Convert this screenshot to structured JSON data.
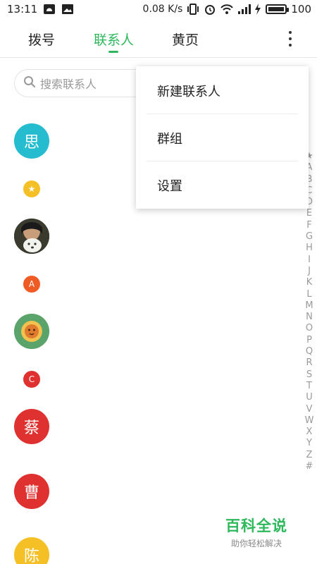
{
  "statusbar": {
    "time": "13:11",
    "speed": "0.08 K/s",
    "battery": "100",
    "battery_level": 1.0
  },
  "tabs": [
    {
      "label": "拨号",
      "active": false
    },
    {
      "label": "联系人",
      "active": true
    },
    {
      "label": "黄页",
      "active": false
    }
  ],
  "search": {
    "placeholder": "搜索联系人"
  },
  "contacts": {
    "avatar_si": "思",
    "chip_star": "★",
    "chip_a": "A",
    "chip_c": "C",
    "avatar_cai": "蔡",
    "avatar_cao": "曹",
    "avatar_chen": "陈"
  },
  "index": [
    "★",
    "A",
    "B",
    "C",
    "D",
    "E",
    "F",
    "G",
    "H",
    "I",
    "J",
    "K",
    "L",
    "M",
    "N",
    "O",
    "P",
    "Q",
    "R",
    "S",
    "T",
    "U",
    "V",
    "W",
    "X",
    "Y",
    "Z",
    "#"
  ],
  "menu": {
    "items": [
      {
        "label": "新建联系人"
      },
      {
        "label": "群组"
      },
      {
        "label": "设置"
      }
    ]
  },
  "watermark": {
    "title": "百科全说",
    "subtitle": "助你轻松解决"
  },
  "colors": {
    "accent": "#2eb85c",
    "teal": "#26bcd0",
    "orange": "#f05a24",
    "red": "#e03131",
    "yellow": "#f5c026"
  }
}
